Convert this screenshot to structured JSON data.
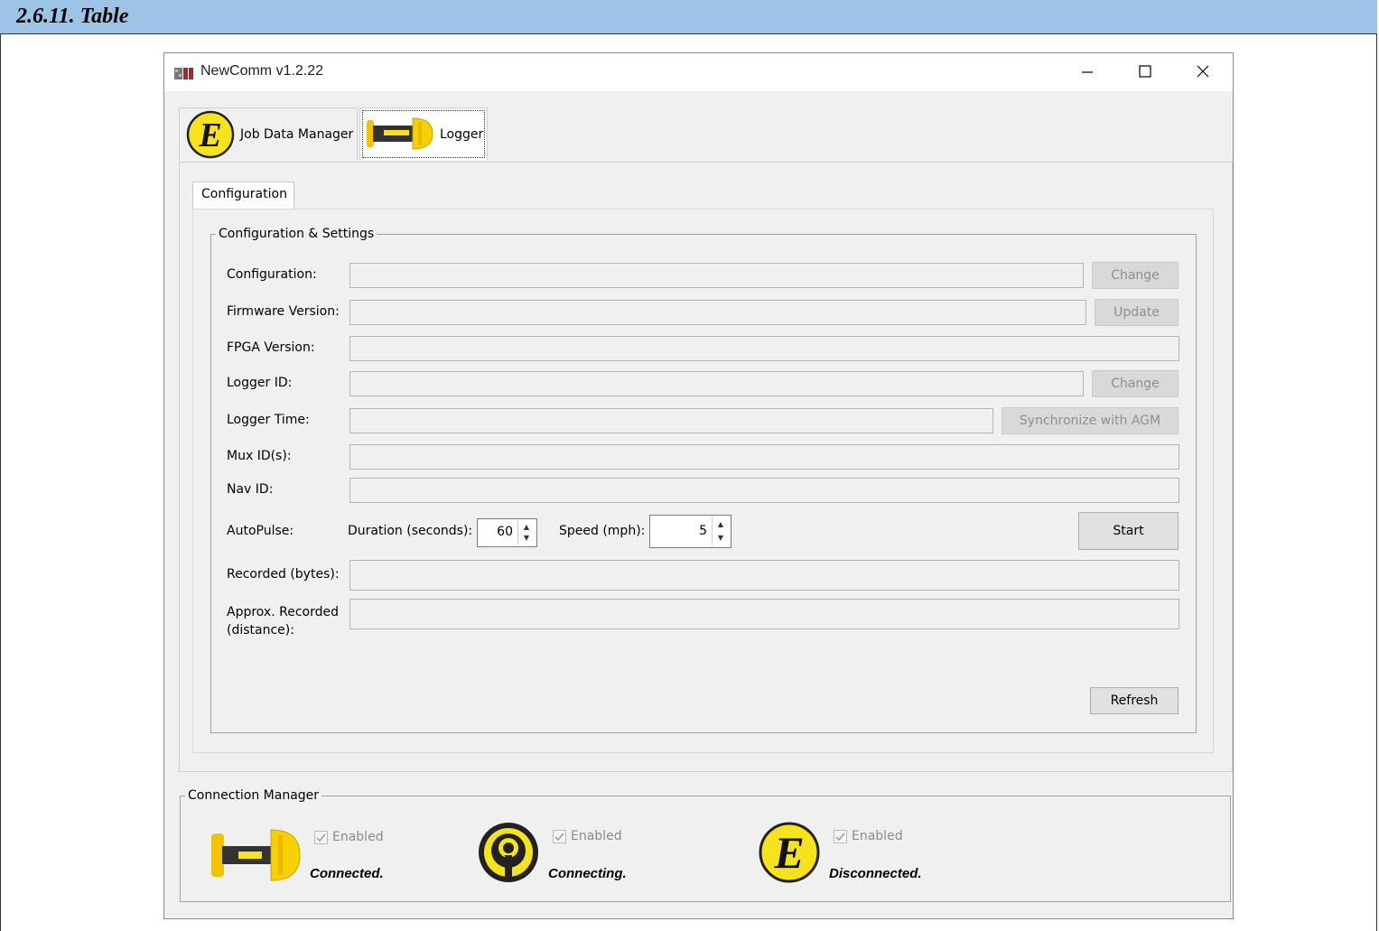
{
  "doc": {
    "heading": "2.6.11. Table"
  },
  "window": {
    "title": "NewComm v1.2.22",
    "icon": "newcomm-app-icon",
    "controls": {
      "minimize": "minimize-icon",
      "maximize": "maximize-icon",
      "close": "close-icon"
    }
  },
  "main_tabs": [
    {
      "label": "Job Data Manager",
      "icon": "e-logo-icon",
      "active": false
    },
    {
      "label": "Logger",
      "icon": "logger-device-icon",
      "active": true
    }
  ],
  "inner_tab": {
    "label": "Configuration"
  },
  "config_group": {
    "legend": "Configuration & Settings",
    "rows": {
      "configuration": {
        "label": "Configuration:",
        "value": "",
        "button": "Change"
      },
      "firmware": {
        "label": "Firmware Version:",
        "value": "",
        "button": "Update"
      },
      "fpga": {
        "label": "FPGA Version:",
        "value": ""
      },
      "logger_id": {
        "label": "Logger ID:",
        "value": "",
        "button": "Change"
      },
      "logger_time": {
        "label": "Logger Time:",
        "value": "",
        "button": "Synchronize with AGM"
      },
      "mux": {
        "label": "Mux ID(s):",
        "value": ""
      },
      "nav": {
        "label": "Nav ID:",
        "value": ""
      },
      "recorded": {
        "label": "Recorded (bytes):",
        "value": ""
      },
      "approx_line1": "Approx. Recorded",
      "approx_line2": "(distance):"
    },
    "autopulse": {
      "label": "AutoPulse:",
      "duration_label": "Duration (seconds):",
      "duration_value": "60",
      "speed_label": "Speed (mph):",
      "speed_value": "5",
      "start_button": "Start"
    },
    "refresh_button": "Refresh"
  },
  "connection_manager": {
    "legend": "Connection Manager",
    "items": [
      {
        "icon": "logger-device-icon",
        "enabled_label": "Enabled",
        "enabled": true,
        "status": "Connected."
      },
      {
        "icon": "antenna-pin-icon",
        "enabled_label": "Enabled",
        "enabled": true,
        "status": "Connecting."
      },
      {
        "icon": "e-logo-icon",
        "enabled_label": "Enabled",
        "enabled": true,
        "status": "Disconnected."
      }
    ]
  },
  "colors": {
    "header_band": "#9dc3e6",
    "logo_yellow": "#f7e31b",
    "window_bg": "#f0f0f0"
  }
}
